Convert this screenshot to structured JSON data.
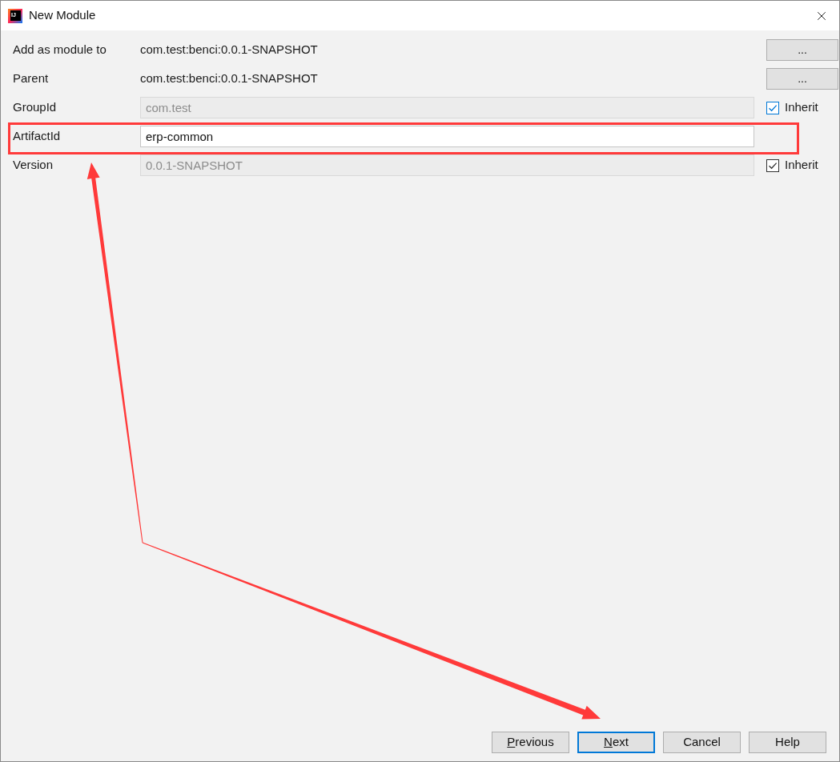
{
  "window": {
    "icon_text": "IJ",
    "title": "New Module"
  },
  "fields": [
    {
      "kind": "text",
      "label": "Add as module to",
      "value": "com.test:benci:0.0.1-SNAPSHOT",
      "button": "...",
      "highlighted": false
    },
    {
      "kind": "text",
      "label": "Parent",
      "value": "com.test:benci:0.0.1-SNAPSHOT",
      "button": "...",
      "highlighted": false
    },
    {
      "kind": "input",
      "label": "GroupId",
      "value": "com.test",
      "disabled": true,
      "highlighted": false,
      "inherit": {
        "label": "Inherit",
        "checked": true,
        "focused": true
      }
    },
    {
      "kind": "input",
      "label": "ArtifactId",
      "value": "erp-common",
      "disabled": false,
      "highlighted": true
    },
    {
      "kind": "input",
      "label": "Version",
      "value": "0.0.1-SNAPSHOT",
      "disabled": true,
      "highlighted": false,
      "inherit": {
        "label": "Inherit",
        "checked": true,
        "focused": false
      }
    }
  ],
  "buttons": [
    {
      "label": "Previous",
      "mnemonic": true,
      "default": false
    },
    {
      "label": "Next",
      "mnemonic": true,
      "default": true
    },
    {
      "label": "Cancel",
      "mnemonic": false,
      "default": false
    },
    {
      "label": "Help",
      "mnemonic": false,
      "default": false
    }
  ]
}
